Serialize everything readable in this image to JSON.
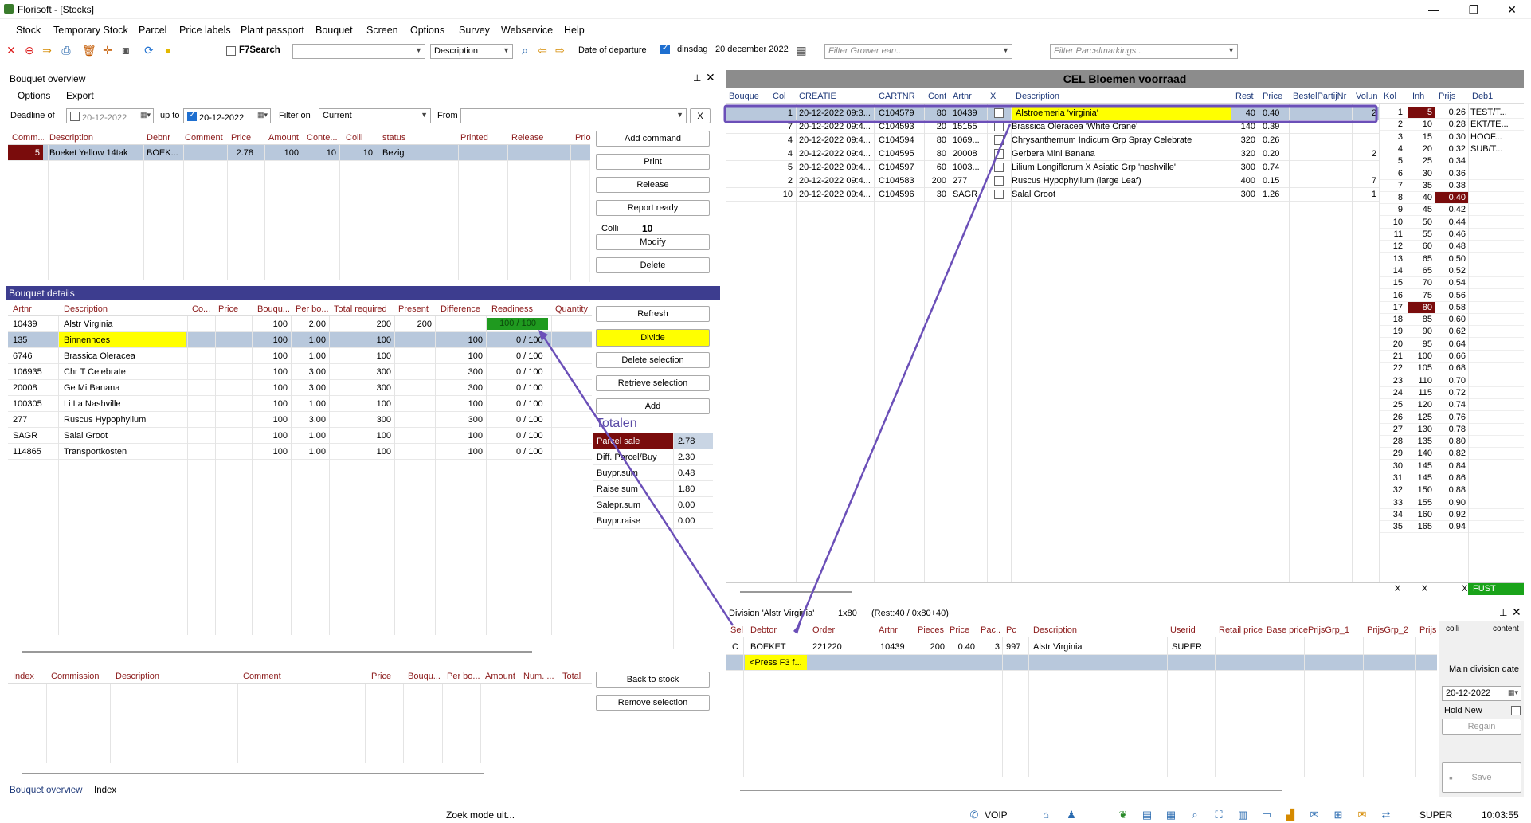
{
  "window": {
    "title": "Florisoft - [Stocks]",
    "minimize": "—",
    "maximize": "❐",
    "close": "✕"
  },
  "menu": [
    "Stock",
    "Temporary Stock",
    "Parcel",
    "Price labels",
    "Plant passport",
    "Bouquet",
    "Screen",
    "Options",
    "Survey",
    "Webservice",
    "Help"
  ],
  "toolbar": {
    "icons": [
      "close-icon",
      "stop-icon",
      "forward-icon",
      "print-icon",
      "trash-icon",
      "move-icon",
      "camera-icon",
      "refresh-icon",
      "bulb-icon"
    ],
    "f7search_label": "F7Search",
    "search_value": "",
    "field_select": "Description",
    "date_of_departure_label": "Date of departure",
    "departure_day": "dinsdag",
    "departure_date": "20 december 2022",
    "filter_grower_placeholder": "Filter Grower ean..",
    "filter_parcel_placeholder": "Filter Parcelmarkings.."
  },
  "bouquet_overview": {
    "title": "Bouquet overview",
    "menu": [
      "Options",
      "Export"
    ],
    "deadline_label": "Deadline of",
    "deadline_value": "20-12-2022",
    "upto_label": "up to",
    "upto_value": "20-12-2022",
    "filter_label": "Filter on",
    "filter_value": "Current",
    "from_label": "From",
    "from_value": "",
    "clear": "X",
    "columns": [
      "Comm...",
      "Description",
      "Debnr",
      "Comment",
      "Price",
      "Amount",
      "Conte...",
      "Colli",
      "status",
      "Printed",
      "Release",
      "Prio"
    ],
    "rows": [
      {
        "comm": "5",
        "description": "Boeket Yellow 14tak",
        "debnr": "BOEK...",
        "comment": "",
        "price": "2.78",
        "amount": "100",
        "content": "10",
        "colli": "10",
        "status": "Bezig"
      }
    ],
    "buttons": {
      "add_command": "Add command",
      "print": "Print",
      "release": "Release",
      "report_ready": "Report ready",
      "modify": "Modify",
      "delete": "Delete"
    },
    "colli_label": "Colli",
    "colli_value": "10"
  },
  "bouquet_details": {
    "title": "Bouquet details",
    "columns": [
      "Artnr",
      "Description",
      "Co...",
      "Price",
      "Bouqu...",
      "Per bo...",
      "Total required",
      "Present",
      "Difference",
      "Readiness",
      "Quantity"
    ],
    "rows": [
      {
        "artnr": "10439",
        "description": "Alstr Virginia",
        "bouq": "100",
        "per": "2.00",
        "total": "200",
        "present": "200",
        "diff": "",
        "ready": "100 / 100"
      },
      {
        "artnr": "135",
        "description": "Binnenhoes",
        "bouq": "100",
        "per": "1.00",
        "total": "100",
        "present": "",
        "diff": "100",
        "ready": "0 / 100"
      },
      {
        "artnr": "6746",
        "description": "Brassica Oleracea",
        "bouq": "100",
        "per": "1.00",
        "total": "100",
        "present": "",
        "diff": "100",
        "ready": "0 / 100"
      },
      {
        "artnr": "106935",
        "description": "Chr T Celebrate",
        "bouq": "100",
        "per": "3.00",
        "total": "300",
        "present": "",
        "diff": "300",
        "ready": "0 / 100"
      },
      {
        "artnr": "20008",
        "description": "Ge Mi Banana",
        "bouq": "100",
        "per": "3.00",
        "total": "300",
        "present": "",
        "diff": "300",
        "ready": "0 / 100"
      },
      {
        "artnr": "100305",
        "description": "Li La Nashville",
        "bouq": "100",
        "per": "1.00",
        "total": "100",
        "present": "",
        "diff": "100",
        "ready": "0 / 100"
      },
      {
        "artnr": "277",
        "description": "Ruscus Hypophyllum",
        "bouq": "100",
        "per": "3.00",
        "total": "300",
        "present": "",
        "diff": "300",
        "ready": "0 / 100"
      },
      {
        "artnr": "SAGR",
        "description": "Salal Groot",
        "bouq": "100",
        "per": "1.00",
        "total": "100",
        "present": "",
        "diff": "100",
        "ready": "0 / 100"
      },
      {
        "artnr": "114865",
        "description": "Transportkosten",
        "bouq": "100",
        "per": "1.00",
        "total": "100",
        "present": "",
        "diff": "100",
        "ready": "0 / 100"
      }
    ],
    "buttons": {
      "refresh": "Refresh",
      "divide": "Divide",
      "delete_selection": "Delete selection",
      "retrieve_selection": "Retrieve selection",
      "add": "Add"
    },
    "totals_title": "Totalen",
    "totals": [
      {
        "label": "Parcel sale",
        "value": "2.78"
      },
      {
        "label": "Diff. Parcel/Buy",
        "value": "2.30"
      },
      {
        "label": "Buypr.sum",
        "value": "0.48"
      },
      {
        "label": "Raise sum",
        "value": "1.80"
      },
      {
        "label": "Salepr.sum",
        "value": "0.00"
      },
      {
        "label": "Buypr.raise",
        "value": "0.00"
      }
    ]
  },
  "index_panel": {
    "columns": [
      "Index",
      "Commission",
      "Description",
      "Comment",
      "Price",
      "Bouqu...",
      "Per bo...",
      "Amount",
      "Num. ...",
      "Total"
    ],
    "buttons": {
      "back_to_stock": "Back to stock",
      "remove_selection": "Remove selection"
    },
    "tabs": [
      "Bouquet overview",
      "Index"
    ]
  },
  "stock": {
    "title": "CEL Bloemen voorraad",
    "columns": [
      "Bouque",
      "Col",
      "CREATIE",
      "CARTNR",
      "Cont",
      "Artnr",
      "X",
      "Description",
      "Rest",
      "Price",
      "BestelPartijNr",
      "Volun",
      "Kol",
      "Inh",
      "Prijs",
      "Deb1"
    ],
    "rows": [
      {
        "col": "1",
        "creatie": "20-12-2022 09:3...",
        "cartnr": "C104579",
        "cont": "80",
        "artnr": "10439",
        "desc": "Alstroemeria 'virginia'",
        "rest": "40",
        "price": "0.40",
        "vol": "2"
      },
      {
        "col": "7",
        "creatie": "20-12-2022 09:4...",
        "cartnr": "C104593",
        "cont": "20",
        "artnr": "15155",
        "desc": "Brassica Oleracea 'White Crane'",
        "rest": "140",
        "price": "0.39",
        "vol": ""
      },
      {
        "col": "4",
        "creatie": "20-12-2022 09:4...",
        "cartnr": "C104594",
        "cont": "80",
        "artnr": "1069...",
        "desc": "Chrysanthemum Indicum Grp Spray Celebrate",
        "rest": "320",
        "price": "0.26",
        "vol": ""
      },
      {
        "col": "4",
        "creatie": "20-12-2022 09:4...",
        "cartnr": "C104595",
        "cont": "80",
        "artnr": "20008",
        "desc": "Gerbera Mini Banana",
        "rest": "320",
        "price": "0.20",
        "vol": "2"
      },
      {
        "col": "5",
        "creatie": "20-12-2022 09:4...",
        "cartnr": "C104597",
        "cont": "60",
        "artnr": "1003...",
        "desc": "Lilium Longiflorum X Asiatic Grp 'nashville'",
        "rest": "300",
        "price": "0.74",
        "vol": ""
      },
      {
        "col": "2",
        "creatie": "20-12-2022 09:4...",
        "cartnr": "C104583",
        "cont": "200",
        "artnr": "277",
        "desc": "Ruscus Hypophyllum (large Leaf)",
        "rest": "400",
        "price": "0.15",
        "vol": "7"
      },
      {
        "col": "10",
        "creatie": "20-12-2022 09:4...",
        "cartnr": "C104596",
        "cont": "30",
        "artnr": "SAGR",
        "desc": "Salal Groot",
        "rest": "300",
        "price": "1.26",
        "vol": "1"
      }
    ],
    "kol_rows": [
      [
        "1",
        "5",
        "0.26",
        "TEST/T..."
      ],
      [
        "2",
        "10",
        "0.28",
        "EKT/TE..."
      ],
      [
        "3",
        "15",
        "0.30",
        "HOOF..."
      ],
      [
        "4",
        "20",
        "0.32",
        "SUB/T..."
      ],
      [
        "5",
        "25",
        "0.34",
        ""
      ],
      [
        "6",
        "30",
        "0.36",
        ""
      ],
      [
        "7",
        "35",
        "0.38",
        ""
      ],
      [
        "8",
        "40",
        "0.40",
        ""
      ],
      [
        "9",
        "45",
        "0.42",
        ""
      ],
      [
        "10",
        "50",
        "0.44",
        ""
      ],
      [
        "11",
        "55",
        "0.46",
        ""
      ],
      [
        "12",
        "60",
        "0.48",
        ""
      ],
      [
        "13",
        "65",
        "0.50",
        ""
      ],
      [
        "14",
        "65",
        "0.52",
        ""
      ],
      [
        "15",
        "70",
        "0.54",
        ""
      ],
      [
        "16",
        "75",
        "0.56",
        ""
      ],
      [
        "17",
        "80",
        "0.58",
        ""
      ],
      [
        "18",
        "85",
        "0.60",
        ""
      ],
      [
        "19",
        "90",
        "0.62",
        ""
      ],
      [
        "20",
        "95",
        "0.64",
        ""
      ],
      [
        "21",
        "100",
        "0.66",
        ""
      ],
      [
        "22",
        "105",
        "0.68",
        ""
      ],
      [
        "23",
        "110",
        "0.70",
        ""
      ],
      [
        "24",
        "115",
        "0.72",
        ""
      ],
      [
        "25",
        "120",
        "0.74",
        ""
      ],
      [
        "26",
        "125",
        "0.76",
        ""
      ],
      [
        "27",
        "130",
        "0.78",
        ""
      ],
      [
        "28",
        "135",
        "0.80",
        ""
      ],
      [
        "29",
        "140",
        "0.82",
        ""
      ],
      [
        "30",
        "145",
        "0.84",
        ""
      ],
      [
        "31",
        "145",
        "0.86",
        ""
      ],
      [
        "32",
        "150",
        "0.88",
        ""
      ],
      [
        "33",
        "155",
        "0.90",
        ""
      ],
      [
        "34",
        "160",
        "0.92",
        ""
      ],
      [
        "35",
        "165",
        "0.94",
        ""
      ]
    ],
    "footer": [
      "X",
      "X",
      "X",
      "FUST"
    ]
  },
  "division": {
    "title": "Division 'Alstr Virginia'",
    "info1": "1x80",
    "info2": "(Rest:40 / 0x80+40)",
    "columns": [
      "Sel",
      "Debtor",
      "Order",
      "Artnr",
      "Pieces",
      "Price",
      "Pac...",
      "Pc",
      "Description",
      "Userid",
      "Retail price",
      "Base price",
      "PrijsGrp_1",
      "PrijsGrp_2",
      "Prijs"
    ],
    "rows": [
      {
        "sel": "C",
        "debtor": "BOEKET",
        "order": "221220",
        "artnr": "10439",
        "pieces": "200",
        "price": "0.40",
        "pac": "3",
        "pc": "997",
        "description": "Alstr Virginia",
        "userid": "SUPER"
      }
    ],
    "new_row": "<Press F3 f...",
    "side": {
      "colli": "colli",
      "content": "content",
      "main_division_date": "Main division date",
      "date": "20-12-2022",
      "hold_new": "Hold New",
      "regain": "Regain",
      "save": "Save"
    }
  },
  "statusbar": {
    "search_mode": "Zoek mode uit...",
    "voip": "VOIP",
    "user": "SUPER",
    "time": "10:03:55"
  }
}
